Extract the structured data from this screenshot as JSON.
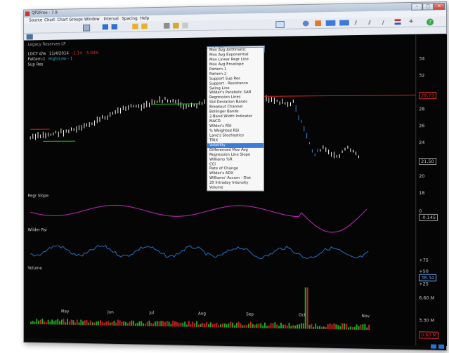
{
  "window": {
    "title": "QP2Free - 7.9",
    "min": "–",
    "max": "□",
    "close": "×"
  },
  "menu": [
    "Source",
    "Chart",
    "Chart Groups",
    "Window",
    "Interval",
    "Spacing",
    "Help"
  ],
  "combo": {
    "value": "Volatility"
  },
  "indicator_menu": [
    "Mov Avg Arithmetic",
    "Mov Avg Exponential",
    "Mov Linear Regr Line",
    "Mov Avg Envelope",
    "Pattern-1",
    "Pattern-2",
    "Support Sup Res",
    "Support - Resistance",
    "Swing Line",
    "Wilder's Parabolic SAR",
    "Regression Lines",
    "Std Deviation Bands",
    "Breakout Channel",
    "Bollinger Bands",
    "2-Band Width Indicator",
    "MACD",
    "Wilder's RSI",
    "% Weighted RSI",
    "Lane's Stochastics",
    "TRIX",
    "Volatility",
    "Differenced Mov Avg",
    "Regression Line Slope",
    "Williams %R",
    "CCI",
    "Rate of Change",
    "Wilder's ADX",
    "Williams' Accum - Dist",
    "20 Intraday Intensity",
    "Volume"
  ],
  "selected_index": 20,
  "chart": {
    "tab": "Legacy Reserves LP",
    "info": {
      "symbol": "LGCY d/w",
      "date": "11/4/2014",
      "change": "-1.14",
      "pct": "-5.04%"
    },
    "pattern_line": {
      "label": "Pattern-1",
      "value": "High/Low - 1"
    },
    "sup_res": "Sup Res",
    "price_axis": [
      "34",
      "32",
      "30",
      "28",
      "26",
      "24",
      "22",
      "20",
      "18"
    ],
    "price_tag_high": "29.73",
    "price_tag_last": "21.50",
    "panes": {
      "slope": {
        "label": "Regr Slope",
        "axis": [
          "0"
        ],
        "tag": "-0.145"
      },
      "rsi": {
        "label": "Wilder Rsi",
        "axis": [
          "+75",
          "+50",
          "+25"
        ],
        "tag": "38.34"
      },
      "volume": {
        "label": "Volume",
        "axis": [
          "6.60 M",
          "3.30 M"
        ],
        "tag": "0.60 M"
      }
    },
    "months": [
      "May",
      "Jun",
      "Jul",
      "Aug",
      "Sep",
      "Oct",
      "Nov"
    ],
    "counts": [
      "9",
      "8",
      "3",
      "5",
      "6",
      "7",
      "9",
      "10",
      "11",
      "12",
      "13",
      "3",
      "2",
      "1",
      "1",
      "12",
      "6",
      "3",
      "9",
      "8",
      "7",
      "4",
      "2",
      "1"
    ]
  },
  "colors": {
    "bg": "#050505",
    "up": "#ffffff",
    "down": "#3a8be0",
    "slope": "#c82dbf",
    "rsi": "#2a73c8",
    "vol_up": "#22aa22",
    "vol_down": "#cc2222",
    "menu_sel": "#3d7bd8"
  }
}
